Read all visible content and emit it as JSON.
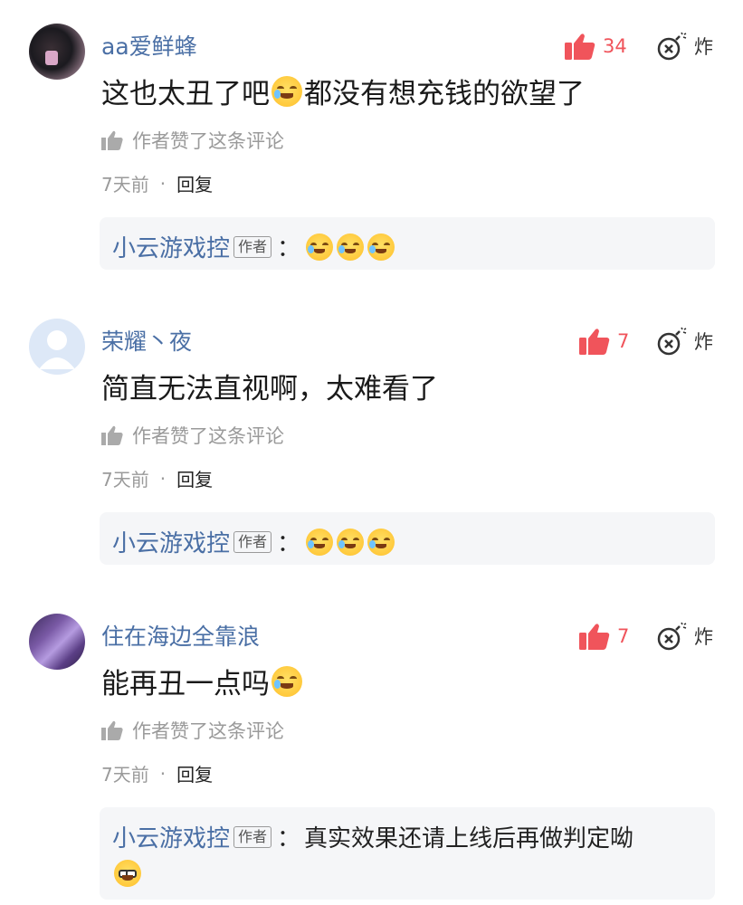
{
  "comments": [
    {
      "username": "aa爱鲜蜂",
      "like_count": "34",
      "bomb_label": "炸",
      "content_parts": [
        "这也太丑了吧",
        "都没有想充钱的欲望了"
      ],
      "author_liked": "作者赞了这条评论",
      "time": "7天前",
      "dot": "·",
      "reply_label": "回复",
      "reply": {
        "name": "小云游戏控",
        "tag": "作者",
        "colon": "：",
        "text": ""
      }
    },
    {
      "username": "荣耀丶夜",
      "like_count": "7",
      "bomb_label": "炸",
      "content_parts": [
        "简直无法直视啊，太难看了"
      ],
      "author_liked": "作者赞了这条评论",
      "time": "7天前",
      "dot": "·",
      "reply_label": "回复",
      "reply": {
        "name": "小云游戏控",
        "tag": "作者",
        "colon": "：",
        "text": ""
      }
    },
    {
      "username": "住在海边全靠浪",
      "like_count": "7",
      "bomb_label": "炸",
      "content_parts": [
        "能再丑一点吗"
      ],
      "author_liked": "作者赞了这条评论",
      "time": "7天前",
      "dot": "·",
      "reply_label": "回复",
      "reply": {
        "name": "小云游戏控",
        "tag": "作者",
        "colon": "：",
        "text": "真实效果还请上线后再做判定呦"
      }
    }
  ],
  "colors": {
    "username": "#4a6fa5",
    "like": "#f0545b",
    "reply_bg": "#f5f6f8",
    "meta": "#9a9a9a"
  },
  "icons": [
    "thumbs-up-icon",
    "bomb-icon",
    "thumbs-up-small-icon",
    "laugh-cry-emoji",
    "nerd-glasses-emoji"
  ]
}
